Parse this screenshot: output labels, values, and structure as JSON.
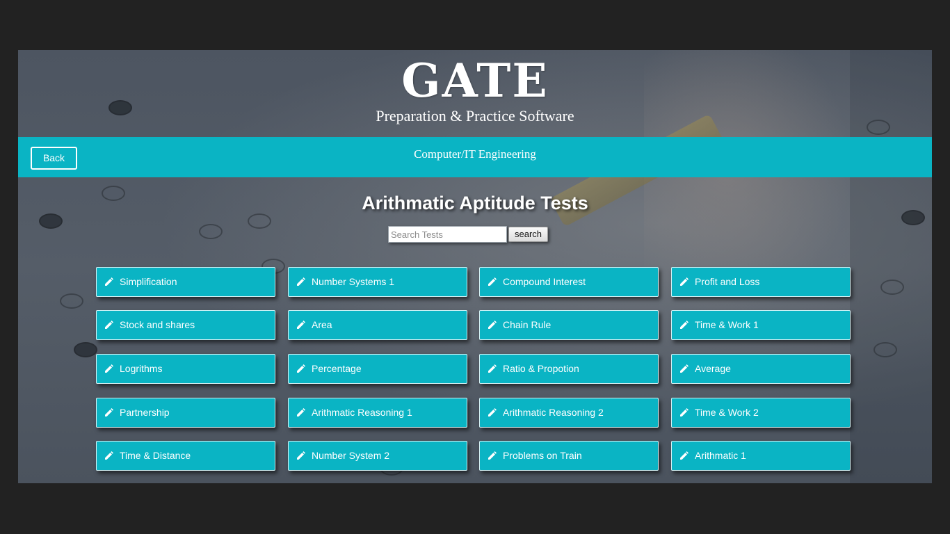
{
  "header": {
    "title": "GATE",
    "subtitle": "Preparation & Practice Software"
  },
  "nav": {
    "back_label": "Back",
    "branch": "Computer/IT Engineering"
  },
  "main": {
    "heading": "Arithmatic Aptitude Tests",
    "search": {
      "placeholder": "Search Tests",
      "value": "",
      "button_label": "search"
    },
    "tests": [
      [
        "Simplification",
        "Number Systems 1",
        "Compound Interest",
        "Profit and Loss"
      ],
      [
        "Stock and shares",
        "Area",
        "Chain Rule",
        "Time & Work 1"
      ],
      [
        "Logrithms",
        "Percentage",
        "Ratio & Propotion",
        "Average"
      ],
      [
        "Partnership",
        "Arithmatic Reasoning 1",
        "Arithmatic Reasoning 2",
        "Time & Work 2"
      ],
      [
        "Time & Distance",
        "Number System 2",
        "Problems on Train",
        "Arithmatic 1"
      ]
    ],
    "test_icon": "pencil-icon"
  },
  "colors": {
    "accent": "#0ab4c4",
    "frame": "#222222",
    "text": "#ffffff"
  }
}
